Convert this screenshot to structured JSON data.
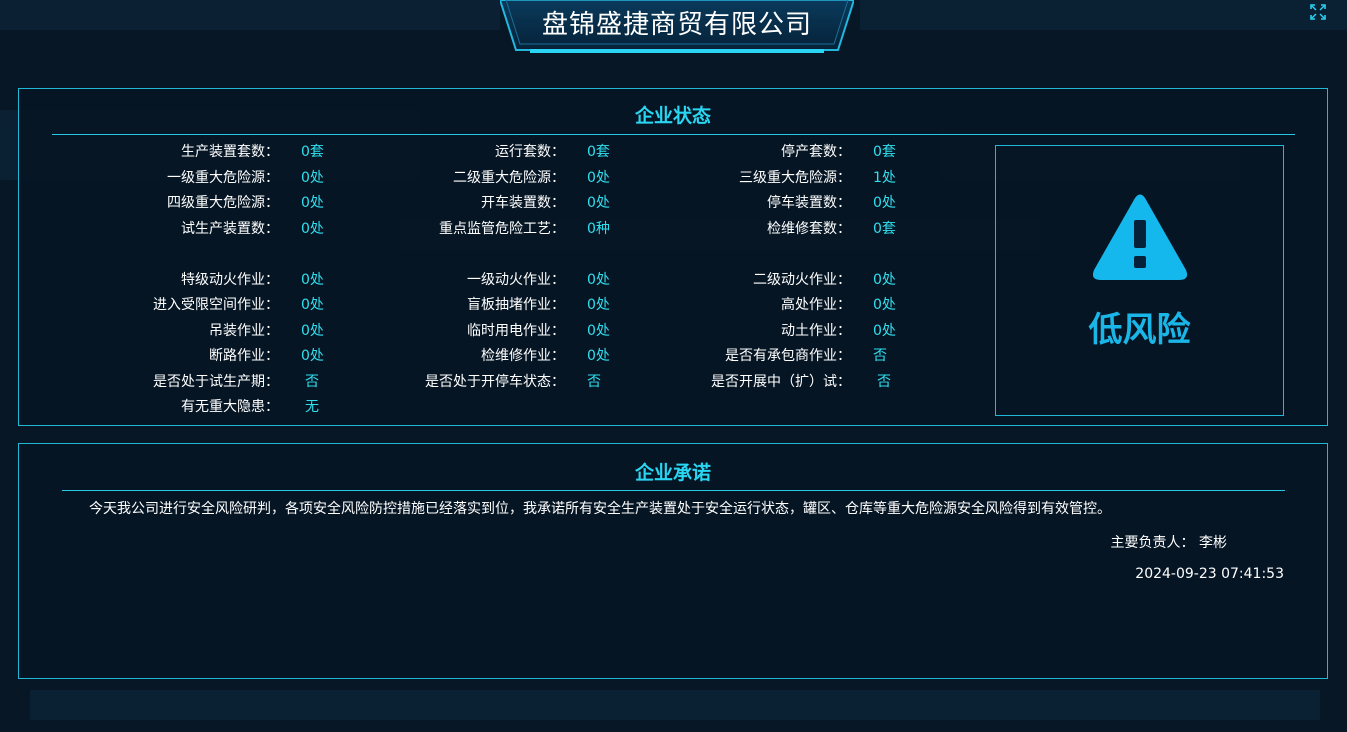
{
  "header": {
    "title": "盘锦盛捷商贸有限公司"
  },
  "status_panel": {
    "title": "企业状态",
    "rows": [
      [
        {
          "label": "生产装置套数：",
          "value": "0套"
        },
        {
          "label": "运行套数：",
          "value": "0套"
        },
        {
          "label": "停产套数：",
          "value": "0套"
        }
      ],
      [
        {
          "label": "一级重大危险源：",
          "value": "0处"
        },
        {
          "label": "二级重大危险源：",
          "value": "0处"
        },
        {
          "label": "三级重大危险源：",
          "value": "1处"
        }
      ],
      [
        {
          "label": "四级重大危险源：",
          "value": "0处"
        },
        {
          "label": "开车装置数：",
          "value": "0处"
        },
        {
          "label": "停车装置数：",
          "value": "0处"
        }
      ],
      [
        {
          "label": "试生产装置数：",
          "value": "0处"
        },
        {
          "label": "重点监管危险工艺：",
          "value": "0种"
        },
        {
          "label": "检维修套数：",
          "value": "0套"
        }
      ],
      [
        {
          "label": "特级动火作业：",
          "value": "0处"
        },
        {
          "label": "一级动火作业：",
          "value": "0处"
        },
        {
          "label": "二级动火作业：",
          "value": "0处"
        }
      ],
      [
        {
          "label": "进入受限空间作业：",
          "value": "0处"
        },
        {
          "label": "盲板抽堵作业：",
          "value": "0处"
        },
        {
          "label": "高处作业：",
          "value": "0处"
        }
      ],
      [
        {
          "label": "吊装作业：",
          "value": "0处"
        },
        {
          "label": "临时用电作业：",
          "value": "0处"
        },
        {
          "label": "动土作业：",
          "value": "0处"
        }
      ],
      [
        {
          "label": "断路作业：",
          "value": "0处"
        },
        {
          "label": "检维修作业：",
          "value": "0处"
        },
        {
          "label": "是否有承包商作业：",
          "value": "否"
        }
      ],
      [
        {
          "label": "是否处于试生产期：",
          "value": "否"
        },
        {
          "label": "是否处于开停车状态：",
          "value": "否"
        },
        {
          "label": "是否开展中（扩）试：",
          "value": "否"
        }
      ],
      [
        {
          "label": "有无重大隐患：",
          "value": "无"
        }
      ]
    ],
    "risk_level": "低风险"
  },
  "promise_panel": {
    "title": "企业承诺",
    "text": "今天我公司进行安全风险研判，各项安全风险防控措施已经落实到位，我承诺所有安全生产装置处于安全运行状态，罐区、仓库等重大危险源安全风险得到有效管控。",
    "person_label": "主要负责人：",
    "person_name": "李彬",
    "datetime": "2024-09-23 07:41:53"
  },
  "colors": {
    "accent": "#29d6f2",
    "value": "#2fe0ef",
    "border": "#1fb8d6",
    "risk": "#1ab6e8",
    "background": "#071726"
  },
  "icons": {
    "expand": "expand-icon",
    "warning": "warning-triangle-icon"
  }
}
